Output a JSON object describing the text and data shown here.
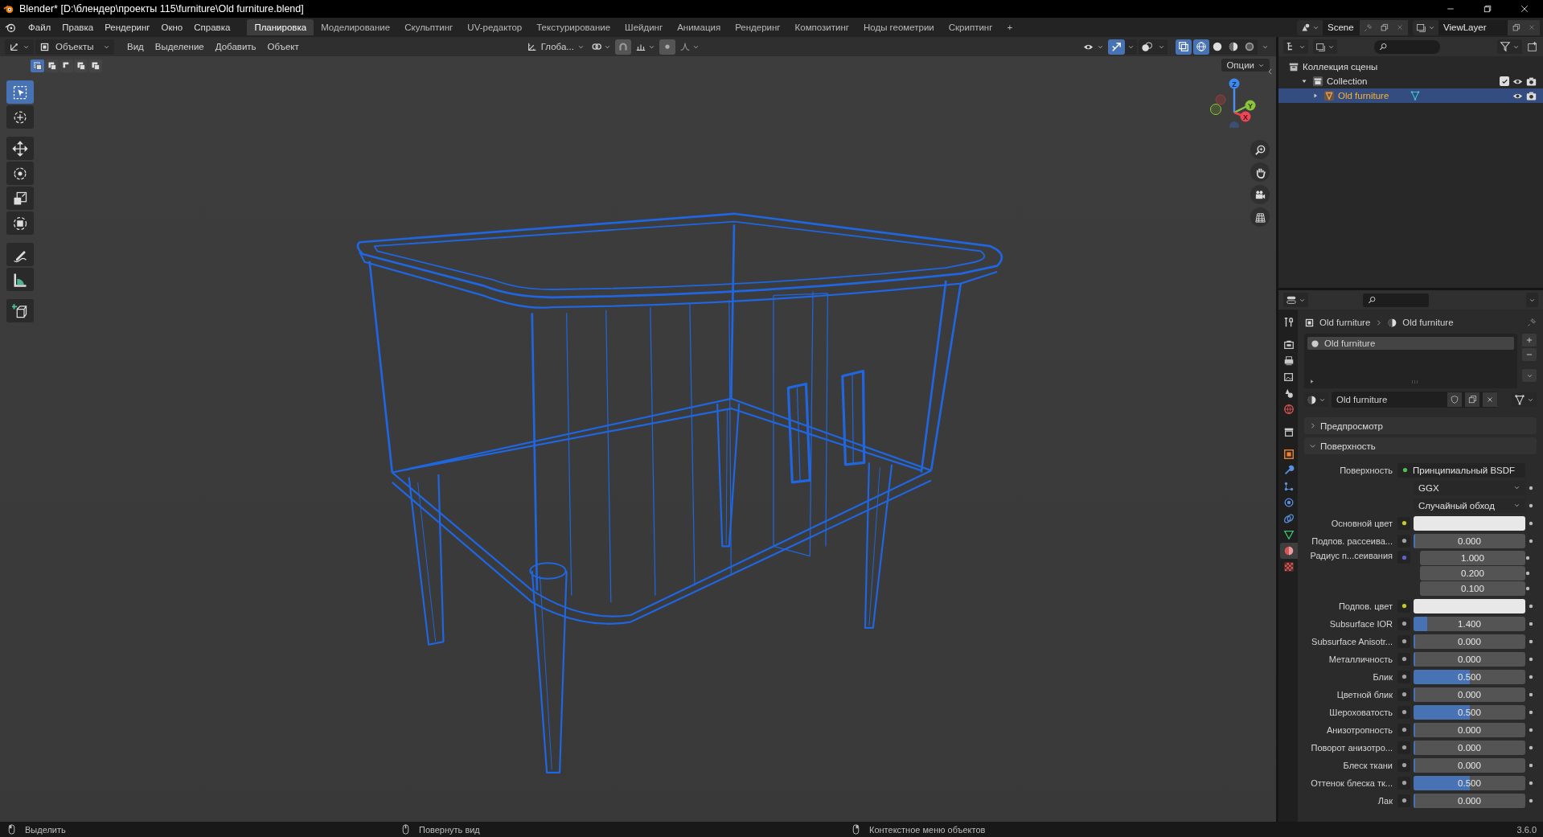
{
  "window": {
    "title": "Blender* [D:\\блендер\\проекты 115\\furniture\\Old furniture.blend]"
  },
  "menu": [
    "Файл",
    "Правка",
    "Рендеринг",
    "Окно",
    "Справка"
  ],
  "workspaces": [
    {
      "label": "Планировка",
      "selected": true
    },
    {
      "label": "Моделирование",
      "selected": false
    },
    {
      "label": "Скульптинг",
      "selected": false
    },
    {
      "label": "UV-редактор",
      "selected": false
    },
    {
      "label": "Текстурирование",
      "selected": false
    },
    {
      "label": "Шейдинг",
      "selected": false
    },
    {
      "label": "Анимация",
      "selected": false
    },
    {
      "label": "Рендеринг",
      "selected": false
    },
    {
      "label": "Композитинг",
      "selected": false
    },
    {
      "label": "Ноды геометрии",
      "selected": false
    },
    {
      "label": "Скриптинг",
      "selected": false
    }
  ],
  "add_workspace": "+",
  "scene": "Scene",
  "view_layer": "ViewLayer",
  "viewport": {
    "mode": "Объекты",
    "menu": [
      "Вид",
      "Выделение",
      "Добавить",
      "Объект"
    ],
    "orientation": "Глоба...",
    "options": "Опции",
    "select_modes": [
      {
        "selected": true
      },
      {
        "selected": false
      },
      {
        "selected": false
      },
      {
        "selected": false
      },
      {
        "selected": false
      }
    ],
    "shading": [
      {
        "selected": true
      },
      {
        "selected": false
      },
      {
        "selected": false
      },
      {
        "selected": false
      }
    ],
    "gizmo_axes": [
      "Z",
      "Y",
      "X"
    ],
    "tools": [
      {
        "selected": true
      },
      {
        "selected": false
      },
      {
        "selected": false
      },
      {
        "selected": false
      },
      {
        "selected": false
      },
      {
        "selected": false
      },
      {
        "selected": false
      },
      {
        "selected": false
      },
      {
        "selected": false
      }
    ]
  },
  "outliner": {
    "tree": [
      {
        "name": "Коллекция сцены",
        "selected": false,
        "children": [
          {
            "name": "Collection",
            "selected": false,
            "expanded": true,
            "checked": true,
            "children": [
              {
                "name": "Old furniture",
                "selected": true,
                "expanded": false
              }
            ]
          }
        ]
      }
    ]
  },
  "properties": {
    "tabs": [
      {
        "selected": false
      },
      {
        "selected": false
      },
      {
        "selected": false
      },
      {
        "selected": false
      },
      {
        "selected": false
      },
      {
        "selected": false
      },
      {
        "selected": false
      },
      {
        "selected": false
      },
      {
        "selected": false
      },
      {
        "selected": false
      },
      {
        "selected": false
      },
      {
        "selected": false
      },
      {
        "selected": false
      },
      {
        "selected": true
      },
      {
        "selected": false
      }
    ],
    "breadcrumb": [
      "Old furniture",
      "Old furniture"
    ],
    "slots": [
      {
        "name": "Old furniture",
        "selected": true
      }
    ],
    "material": "Old furniture",
    "panels": [
      {
        "title": "Предпросмотр",
        "expanded": false
      },
      {
        "title": "Поверхность",
        "expanded": true
      }
    ],
    "rows": [
      {
        "kind": "shader",
        "label": "Поверхность",
        "value": "Принципиальный BSDF",
        "color": "#4fc14f"
      },
      {
        "kind": "enum",
        "value": "GGX"
      },
      {
        "kind": "enum",
        "value": "Случайный обход"
      },
      {
        "kind": "color",
        "label": "Основной цвет",
        "color": "#c7c729"
      },
      {
        "kind": "number",
        "label": "Подпов. рассеива...",
        "value": "0.000",
        "level": 0,
        "color": "#a1a1a1"
      },
      {
        "kind": "vector",
        "label": "Радиус п...сеивания",
        "values": [
          "1.000",
          "0.200",
          "0.100"
        ],
        "color": "#6363c7"
      },
      {
        "kind": "color",
        "label": "Подпов. цвет",
        "color": "#c7c729"
      },
      {
        "kind": "number",
        "label": "Subsurface IOR",
        "value": "1.400",
        "level": 0.12,
        "color": "#a1a1a1"
      },
      {
        "kind": "number",
        "label": "Subsurface Anisotr...",
        "value": "0.000",
        "level": 0,
        "color": "#a1a1a1"
      },
      {
        "kind": "number",
        "label": "Металличность",
        "value": "0.000",
        "level": 0,
        "color": "#a1a1a1"
      },
      {
        "kind": "number",
        "label": "Блик",
        "value": "0.500",
        "level": 0.5,
        "color": "#a1a1a1"
      },
      {
        "kind": "number",
        "label": "Цветной блик",
        "value": "0.000",
        "level": 0,
        "color": "#a1a1a1"
      },
      {
        "kind": "number",
        "label": "Шероховатость",
        "value": "0.500",
        "level": 0.5,
        "color": "#a1a1a1"
      },
      {
        "kind": "number",
        "label": "Анизотропность",
        "value": "0.000",
        "level": 0,
        "color": "#a1a1a1"
      },
      {
        "kind": "number",
        "label": "Поворот анизотро...",
        "value": "0.000",
        "level": 0,
        "color": "#a1a1a1"
      },
      {
        "kind": "number",
        "label": "Блеск ткани",
        "value": "0.000",
        "level": 0,
        "color": "#a1a1a1"
      },
      {
        "kind": "number",
        "label": "Оттенок блеска тк...",
        "value": "0.500",
        "level": 0.5,
        "color": "#a1a1a1"
      },
      {
        "kind": "number",
        "label": "Лак",
        "value": "0.000",
        "level": 0,
        "color": "#a1a1a1"
      }
    ]
  },
  "status_bar": {
    "hints": [
      "Выделить",
      "Повернуть вид",
      "Контекстное меню объектов"
    ],
    "version": "3.6.0"
  }
}
